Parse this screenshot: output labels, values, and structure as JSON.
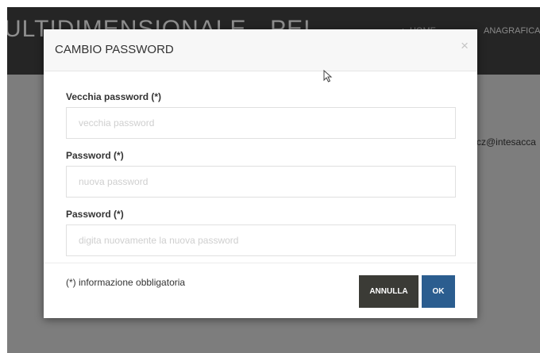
{
  "app": {
    "title": "ULTIDIMENSIONALE - PEI",
    "nav": {
      "home": "▲ HOME",
      "anagrafica": "ANAGRAFICA"
    },
    "user_email": "cz@intesacca"
  },
  "modal": {
    "title": "CAMBIO PASSWORD",
    "close_symbol": "×",
    "fields": [
      {
        "label": "Vecchia password (*)",
        "value": "",
        "placeholder": "vecchia password"
      },
      {
        "label": "Password (*)",
        "value": "",
        "placeholder": "nuova password"
      },
      {
        "label": "Password (*)",
        "value": "",
        "placeholder": "digita nuovamente la nuova password"
      }
    ],
    "footer_note": "(*) informazione obbligatoria",
    "buttons": {
      "cancel": "ANNULLA",
      "ok": "OK"
    }
  },
  "colors": {
    "header_bg": "#252525",
    "overlay_bg": "#7d7d7d",
    "cancel_bg": "#3b3b36",
    "ok_bg": "#2b5d8f"
  },
  "icons": {
    "pointer": "mouse-cursor-icon",
    "close": "close-icon"
  }
}
